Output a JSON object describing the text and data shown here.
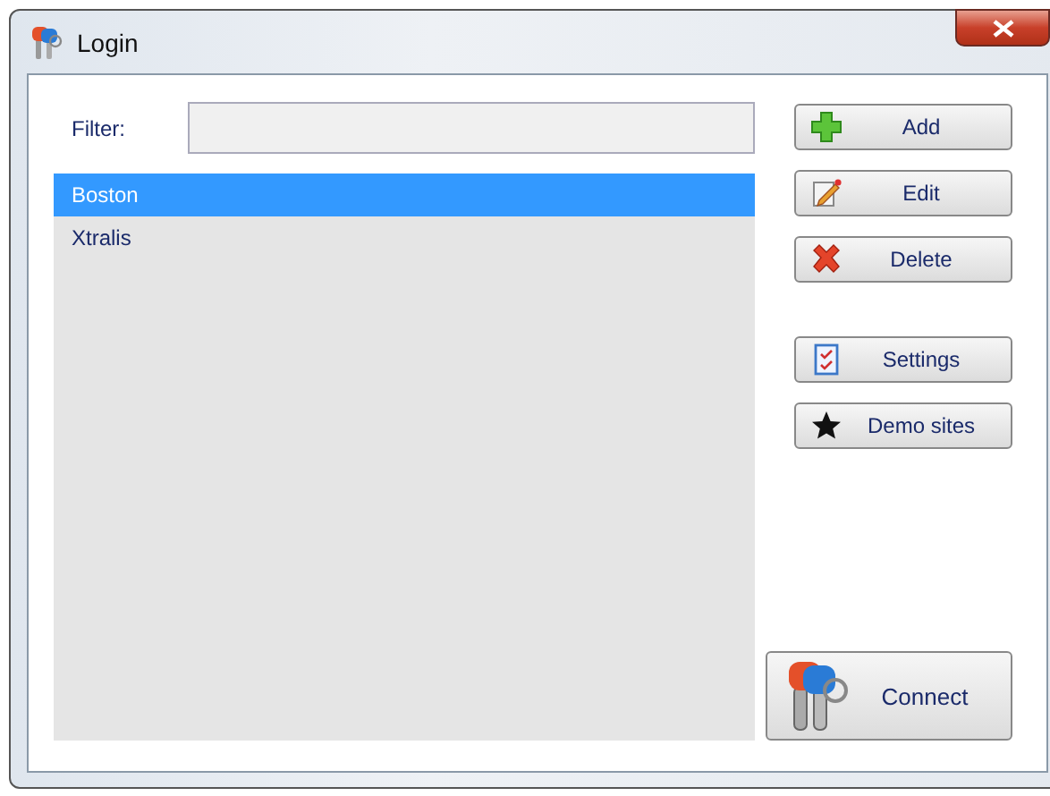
{
  "window": {
    "title": "Login"
  },
  "filter": {
    "label": "Filter:"
  },
  "sites": [
    {
      "name": "Boston",
      "selected": true
    },
    {
      "name": "Xtralis",
      "selected": false
    }
  ],
  "button_groups": [
    [
      {
        "label": "Add",
        "kind": "add"
      },
      {
        "label": "Edit",
        "kind": "edit"
      },
      {
        "label": "Delete",
        "kind": "delete"
      }
    ],
    [
      {
        "label": "Settings",
        "kind": "settings"
      },
      {
        "label": "Demo sites",
        "kind": "star"
      }
    ]
  ],
  "connect": {
    "label": "Connect"
  }
}
